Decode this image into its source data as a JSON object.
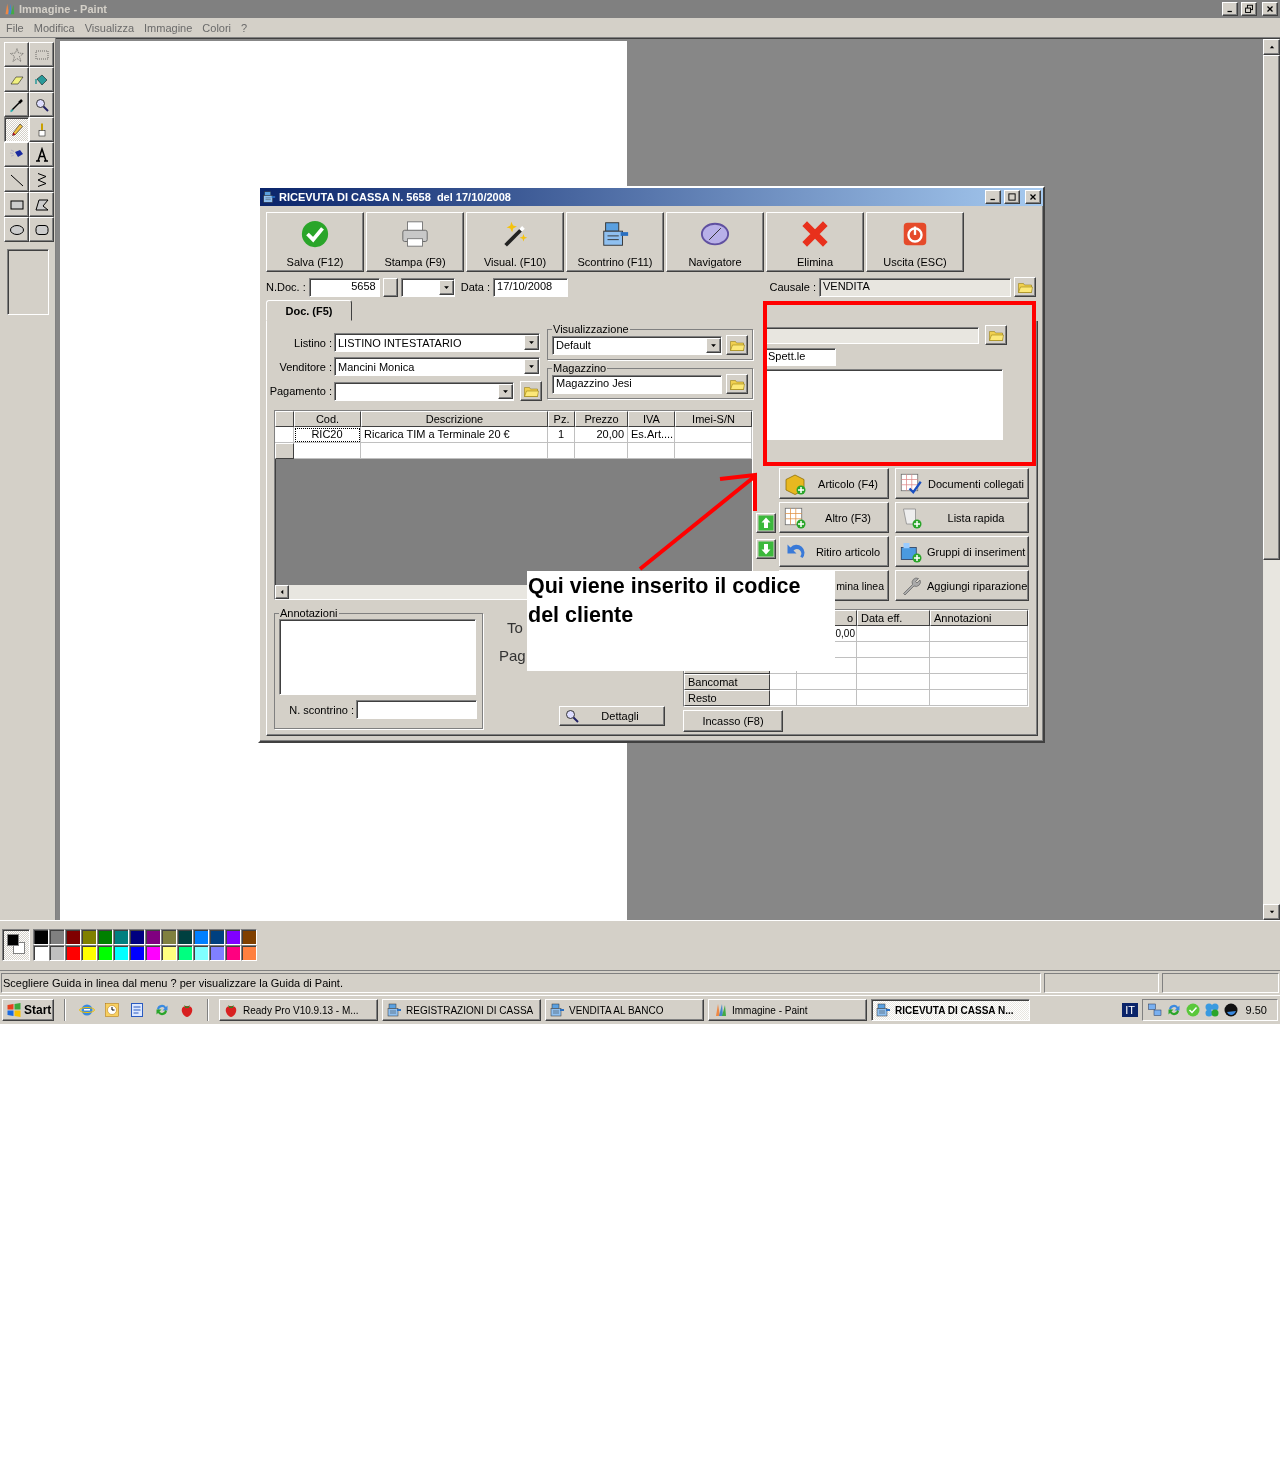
{
  "paint": {
    "title": "Immagine - Paint",
    "menu": [
      "File",
      "Modifica",
      "Visualizza",
      "Immagine",
      "Colori",
      "?"
    ],
    "tools": [
      {
        "kind": "free-select",
        "selected": false
      },
      {
        "kind": "rect-select",
        "selected": false
      },
      {
        "kind": "eraser",
        "selected": false
      },
      {
        "kind": "fill",
        "selected": false
      },
      {
        "kind": "picker",
        "selected": false
      },
      {
        "kind": "magnifier",
        "selected": false
      },
      {
        "kind": "pencil",
        "selected": true
      },
      {
        "kind": "brush",
        "selected": false
      },
      {
        "kind": "airbrush",
        "selected": false
      },
      {
        "kind": "text",
        "selected": false
      },
      {
        "kind": "line",
        "selected": false
      },
      {
        "kind": "curve",
        "selected": false
      },
      {
        "kind": "rectangle",
        "selected": false
      },
      {
        "kind": "polygon",
        "selected": false
      },
      {
        "kind": "ellipse",
        "selected": false
      },
      {
        "kind": "rounded-rect",
        "selected": false
      }
    ],
    "palette": {
      "colors": [
        {
          "color": "#000000"
        },
        {
          "color": "#808080"
        },
        {
          "color": "#800000"
        },
        {
          "color": "#808000"
        },
        {
          "color": "#008000"
        },
        {
          "color": "#008080"
        },
        {
          "color": "#000080"
        },
        {
          "color": "#800080"
        },
        {
          "color": "#808040"
        },
        {
          "color": "#004040"
        },
        {
          "color": "#0080ff"
        },
        {
          "color": "#004080"
        },
        {
          "color": "#8000ff"
        },
        {
          "color": "#804000"
        },
        {
          "color": "#ffffff"
        },
        {
          "color": "#c0c0c0"
        },
        {
          "color": "#ff0000"
        },
        {
          "color": "#ffff00"
        },
        {
          "color": "#00ff00"
        },
        {
          "color": "#00ffff"
        },
        {
          "color": "#0000ff"
        },
        {
          "color": "#ff00ff"
        },
        {
          "color": "#ffff80"
        },
        {
          "color": "#00ff80"
        },
        {
          "color": "#80ffff"
        },
        {
          "color": "#8080ff"
        },
        {
          "color": "#ff0080"
        },
        {
          "color": "#ff8040"
        }
      ]
    },
    "status_bar": {
      "text": "Scegliere Guida in linea dal menu ? per visualizzare la Guida di Paint."
    }
  },
  "dialog": {
    "title": "RICEVUTA DI CASSA N. 5658  del 17/10/2008",
    "toolbar": [
      {
        "kind": "check",
        "label": "Salva (F12)"
      },
      {
        "kind": "printer",
        "label": "Stampa (F9)"
      },
      {
        "kind": "wand",
        "label": "Visual. (F10)"
      },
      {
        "kind": "register",
        "label": "Scontrino (F11)"
      },
      {
        "kind": "compass",
        "label": "Navigatore"
      },
      {
        "kind": "cross",
        "label": "Elimina"
      },
      {
        "kind": "power",
        "label": "Uscita (ESC)"
      }
    ],
    "header": {
      "ndoc_label": "N.Doc. :",
      "ndoc": "5658",
      "data_label": "Data :",
      "data": "17/10/2008",
      "causale_label": "Causale :",
      "causale": "VENDITA"
    },
    "tabs": [
      {
        "label": "Doc. (F5)",
        "selected": true
      }
    ],
    "fields": [
      {
        "label": "Listino :",
        "value": "LISTINO INTESTATARIO"
      },
      {
        "label": "Venditore :",
        "value": "Mancini Monica"
      },
      {
        "label": "Pagamento :"
      }
    ],
    "visualizzazione": {
      "legend": "Visualizzazione",
      "value": "Default"
    },
    "magazzino": {
      "legend": "Magazzino",
      "value": "Magazzino Jesi"
    },
    "customer": {
      "title_value": "Spett.le"
    },
    "grid": {
      "columns": [
        "Cod.",
        "Descrizione",
        "Pz.",
        "Prezzo",
        "IVA",
        "Imei-S/N"
      ],
      "rows": [
        {
          "cells": [
            "RIC20",
            "Ricarica TIM a Terminale 20 €",
            "1",
            "20,00",
            "Es.Art...."
          ]
        }
      ]
    },
    "actions": [
      {
        "kind": "box-add",
        "label": "Articolo (F4)"
      },
      {
        "kind": "doc-check",
        "label": "Documenti collegati"
      },
      {
        "kind": "grid-add",
        "label": "Altro (F3)"
      },
      {
        "kind": "scroll-add",
        "label": "Lista rapida"
      },
      {
        "kind": "undo",
        "label": "Ritiro articolo"
      },
      {
        "kind": "group-add",
        "label": "Gruppi di inseriment"
      },
      {
        "kind": "none",
        "label": "mina linea"
      },
      {
        "kind": "wrench",
        "label": "Aggiungi riparazione"
      }
    ],
    "annotazioni": {
      "legend": "Annotazioni",
      "scontrino_label": "N. scontrino :"
    },
    "totals": [
      "To",
      "Pag"
    ],
    "dettagli": "Dettagli",
    "payments": {
      "columns": [
        "o",
        "Data eff.",
        "Annotazioni"
      ],
      "rows": [
        {
          "amount": "0,00"
        },
        {},
        {},
        {
          "label": "Bancomat"
        },
        {
          "label": "Resto"
        }
      ]
    },
    "incasso": "Incasso (F8)"
  },
  "annotation": {
    "text": "Qui viene inserito il codice del cliente"
  },
  "taskbar": {
    "start": "Start",
    "quick_launch": [
      {
        "kind": "browser"
      },
      {
        "kind": "clock"
      },
      {
        "kind": "document"
      },
      {
        "kind": "sync"
      },
      {
        "kind": "strawberry"
      }
    ],
    "tasks": [
      {
        "kind": "strawberry",
        "label": "Ready Pro V10.9.13 - M...",
        "selected": false
      },
      {
        "kind": "register",
        "label": "REGISTRAZIONI DI CASSA",
        "selected": false
      },
      {
        "kind": "register",
        "label": "VENDITA AL BANCO",
        "selected": false
      },
      {
        "kind": "paint",
        "label": "Immagine - Paint",
        "selected": false
      },
      {
        "kind": "register",
        "label": "RICEVUTA DI CASSA N...",
        "selected": true
      }
    ],
    "language": "IT",
    "tray": [
      {
        "kind": "network"
      },
      {
        "kind": "sync"
      },
      {
        "kind": "messenger"
      },
      {
        "kind": "clover"
      },
      {
        "kind": "globe"
      }
    ],
    "clock": "9.50"
  }
}
